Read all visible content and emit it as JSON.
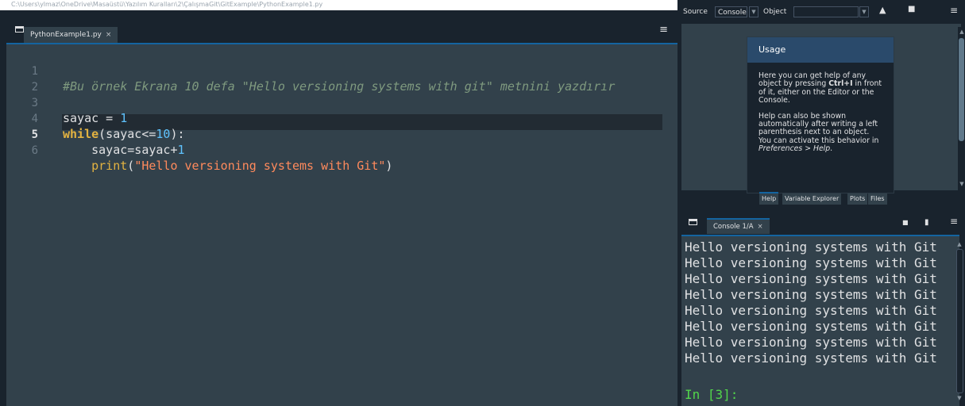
{
  "editor": {
    "path": "C:\\Users\\ylmaz\\OneDrive\\Masaüstü\\Yazılım Kuralları\\2\\ÇalışmaGit\\GitExample\\PythonExample1.py",
    "tab_label": "PythonExample1.py",
    "tab_close": "×",
    "menu_icon": "≡",
    "lines": [
      {
        "num": "1",
        "comment": "#Bu örnek Ekrana 10 defa \"Hello versioning systems with git\" metnini yazdırır"
      },
      {
        "num": "2"
      },
      {
        "num": "3",
        "var": "sayac",
        "op": " = ",
        "value": "1"
      },
      {
        "num": "4",
        "keyword": "while",
        "rest": "(sayac<=",
        "value": "10",
        "close": "):"
      },
      {
        "num": "5",
        "indent": "    ",
        "rest": "sayac=sayac+",
        "value": "1",
        "active": true
      },
      {
        "num": "6",
        "indent": "    ",
        "builtin": "print",
        "open": "(",
        "string": "\"Hello versioning systems with Git\"",
        "close": ")"
      }
    ]
  },
  "help": {
    "toolbar": {
      "source_label": "Source",
      "source_value": "Console",
      "object_label": "Object",
      "object_value": ""
    },
    "usage_title": "Usage",
    "usage_p1_a": "Here you can get help of any object by pressing ",
    "usage_p1_key": "Ctrl+I",
    "usage_p1_b": " in front of it, either on the Editor or the Console.",
    "usage_p2_a": "Help can also be shown automatically after writing a left parenthesis next to an object. You can activate this behavior in ",
    "usage_p2_em": "Preferences > Help",
    "usage_p2_b": ".",
    "tabs": [
      "Help",
      "Variable Explorer",
      "Plots",
      "Files"
    ]
  },
  "console": {
    "tab_label": "Console 1/A",
    "tab_close": "×",
    "output": [
      "Hello versioning systems with Git",
      "Hello versioning systems with Git",
      "Hello versioning systems with Git",
      "Hello versioning systems with Git",
      "Hello versioning systems with Git",
      "Hello versioning systems with Git",
      "Hello versioning systems with Git",
      "Hello versioning systems with Git"
    ],
    "prompt": "In [3]:"
  },
  "colors": {
    "background": "#19232d",
    "panel": "#32414b",
    "accent": "#1464a0",
    "prompt": "#52d64b"
  }
}
